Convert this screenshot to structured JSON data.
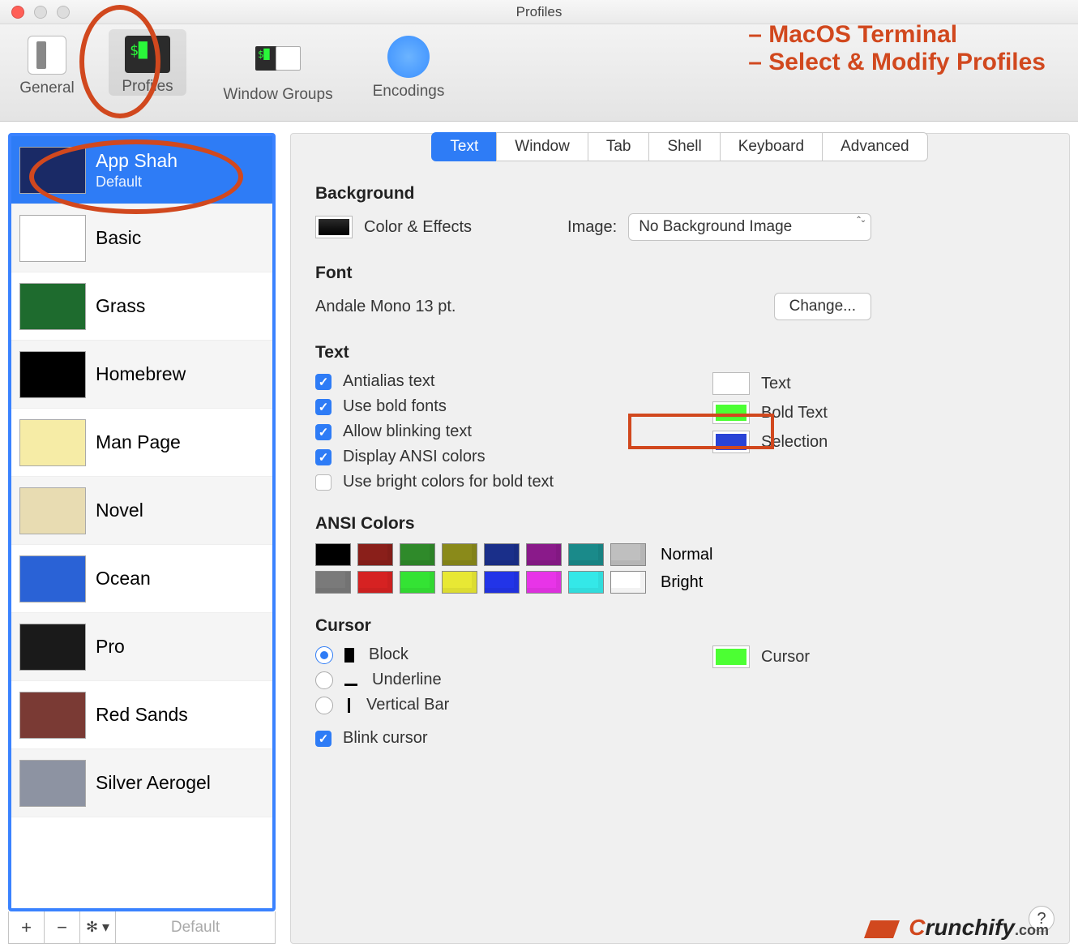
{
  "window": {
    "title": "Profiles"
  },
  "annotations": {
    "line1": "– MacOS Terminal",
    "line2": "– Select & Modify Profiles",
    "brand_c": "C",
    "brand_body": "runchify",
    "brand_com": ".com"
  },
  "toolbar": {
    "general": "General",
    "profiles": "Profiles",
    "groups": "Window Groups",
    "encodings": "Encodings"
  },
  "profiles": [
    {
      "name": "App Shah",
      "sub": "Default",
      "bg": "#1a2a66",
      "sel": true
    },
    {
      "name": "Basic",
      "bg": "#ffffff"
    },
    {
      "name": "Grass",
      "bg": "#1e6b2e"
    },
    {
      "name": "Homebrew",
      "bg": "#000000"
    },
    {
      "name": "Man Page",
      "bg": "#f6eca6"
    },
    {
      "name": "Novel",
      "bg": "#e8dcb2"
    },
    {
      "name": "Ocean",
      "bg": "#2a62d6"
    },
    {
      "name": "Pro",
      "bg": "#1a1a1a"
    },
    {
      "name": "Red Sands",
      "bg": "#7a3a34"
    },
    {
      "name": "Silver Aerogel",
      "bg": "#8d93a2"
    }
  ],
  "footer": {
    "default": "Default"
  },
  "tabs": [
    "Text",
    "Window",
    "Tab",
    "Shell",
    "Keyboard",
    "Advanced"
  ],
  "sections": {
    "background": {
      "heading": "Background",
      "swatch_label": "Color & Effects",
      "image_label": "Image:",
      "image_value": "No Background Image"
    },
    "font": {
      "heading": "Font",
      "value": "Andale Mono 13 pt.",
      "change": "Change..."
    },
    "text": {
      "heading": "Text",
      "opts": {
        "antialias": "Antialias text",
        "bold": "Use bold fonts",
        "blink": "Allow blinking text",
        "ansi": "Display ANSI colors",
        "bright": "Use bright colors for bold text"
      },
      "swatches": {
        "text": {
          "label": "Text",
          "color": "#ffffff"
        },
        "bold": {
          "label": "Bold Text",
          "color": "#4cff33"
        },
        "sel": {
          "label": "Selection",
          "color": "#2943d6"
        }
      }
    },
    "ansi": {
      "heading": "ANSI Colors",
      "normal_label": "Normal",
      "bright_label": "Bright",
      "normal": [
        "#000000",
        "#8a1f1a",
        "#2f8a2a",
        "#8a8a1a",
        "#1a2f8a",
        "#8a1a8a",
        "#1a8a8a",
        "#bfbfbf"
      ],
      "bright": [
        "#7a7a7a",
        "#d62222",
        "#34e334",
        "#e8e834",
        "#2234e8",
        "#e834e8",
        "#34e8e8",
        "#ffffff"
      ]
    },
    "cursor": {
      "heading": "Cursor",
      "block": "Block",
      "underline": "Underline",
      "vbar": "Vertical Bar",
      "blink": "Blink cursor",
      "swatch_label": "Cursor",
      "swatch_color": "#4cff33"
    }
  }
}
